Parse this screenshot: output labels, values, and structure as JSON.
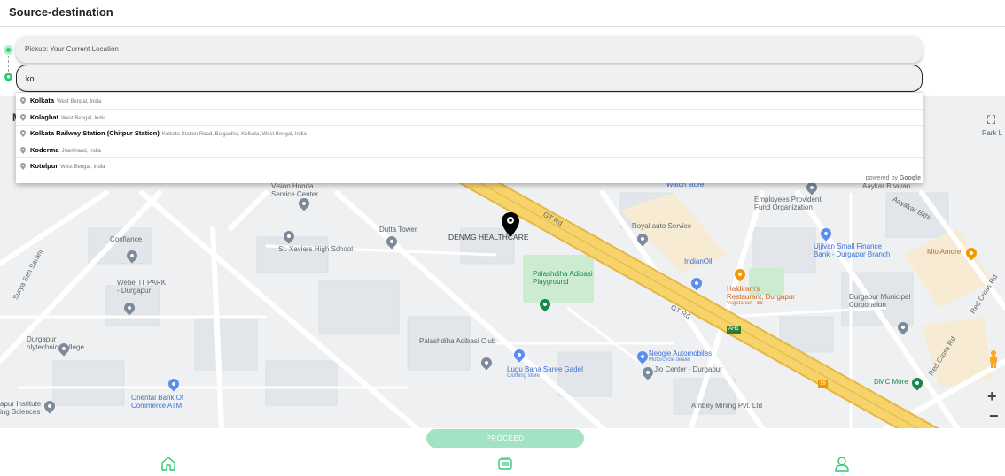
{
  "header": {
    "title": "Source-destination"
  },
  "route": {
    "pickup_text": "Pickup: Your Current Location",
    "drop_value": "ko"
  },
  "suggestions": [
    {
      "match": "Ko",
      "rest": "lkata",
      "secondary": "West Bengal, India"
    },
    {
      "match": "Ko",
      "rest": "laghat",
      "secondary": "West Bengal, India"
    },
    {
      "match": "Ko",
      "rest": "lkata Railway Station (Chitpur Station)",
      "secondary": "Kolkata Station Road, Belgachia, Kolkata, West Bengal, India"
    },
    {
      "match": "Ko",
      "rest": "derma",
      "secondary": "Jharkhand, India"
    },
    {
      "match": "Ko",
      "rest": "tulpur",
      "secondary": "West Bengal, India"
    }
  ],
  "powered_by": {
    "prefix": "powered by",
    "brand": "Google"
  },
  "map": {
    "partial_letter": "M",
    "park_label": "Park L",
    "roads": [
      {
        "label": "GT Rd",
        "id": "gt-rd-1"
      },
      {
        "label": "GT Rd",
        "id": "gt-rd-2"
      },
      {
        "label": "Surya Sen Sarani",
        "id": "surya-sen-sarani"
      },
      {
        "label": "Aayakar Bithi",
        "id": "aayakar-bithi"
      },
      {
        "label": "Red Cross Rd",
        "id": "red-cross-rd-1"
      },
      {
        "label": "Red Cross Rd",
        "id": "red-cross-rd-2"
      },
      {
        "label": "AH1",
        "id": "ah1-shield"
      },
      {
        "label": "19",
        "id": "nh19-shield"
      }
    ],
    "places": {
      "vision_honda": "Vision Honda",
      "vision_honda_2": "Service Center",
      "dutta_tower": "Dutta Tower",
      "denmg": "DENMG HEALTHCARE",
      "st_xaviers": "St. Xaviers High School",
      "confiance": "Confiance",
      "webel_1": "Webel IT PARK",
      "webel_2": "- Durgapur",
      "royal_auto": "Royal auto Service",
      "indianoil": "IndianOil",
      "haldirams_1": "Haldiram's",
      "haldirams_2": "Restaurant, Durgapur",
      "haldirams_3": "Vegetarian · $$",
      "palashdiha_pg_1": "Palashdiha Adibasi",
      "palashdiha_pg_2": "Playground",
      "palashdiha_club": "Palashdiha Adibasi Club",
      "lugu_1": "Lugu Baha Saree Gadel",
      "lugu_2": "Clothing store",
      "neogie_1": "Neogie Automobiles",
      "neogie_2": "Motorcycle dealer",
      "jio": "Jio Center - Durgapur",
      "ambey": "Ambey Mining Pvt. Ltd",
      "dmc": "DMC More",
      "epfo_1": "Employees Provident",
      "epfo_2": "Fund Organization",
      "aayakar_bhavan": "Aaykar Bhavan",
      "ujjivan_1": "Ujjivan Small Finance",
      "ujjivan_2": "Bank - Durgapur Branch",
      "mio_amore": "Mio Amore",
      "dmc_corp_1": "Durgapur Municipal",
      "dmc_corp_2": "Corporation",
      "durgapur_poly_1": "Durgapur",
      "durgapur_poly_2": "olytechnic College",
      "oriental_1": "Oriental Bank Of",
      "oriental_2": "Commerce ATM",
      "institute_1": "apur Institute",
      "institute_2": "ing Sciences",
      "watch_store": "Watch store"
    }
  },
  "controls": {
    "zoom_in": "+",
    "zoom_out": "−"
  },
  "footer": {
    "proceed_label": "PROCEED",
    "nav_icons": [
      "home-icon",
      "orders-icon",
      "profile-icon"
    ]
  },
  "colors": {
    "accent": "#2ecc71",
    "proceed_bg": "#a3e3c3",
    "highway": "#f6d36b",
    "map_bg": "#eef0f2"
  }
}
